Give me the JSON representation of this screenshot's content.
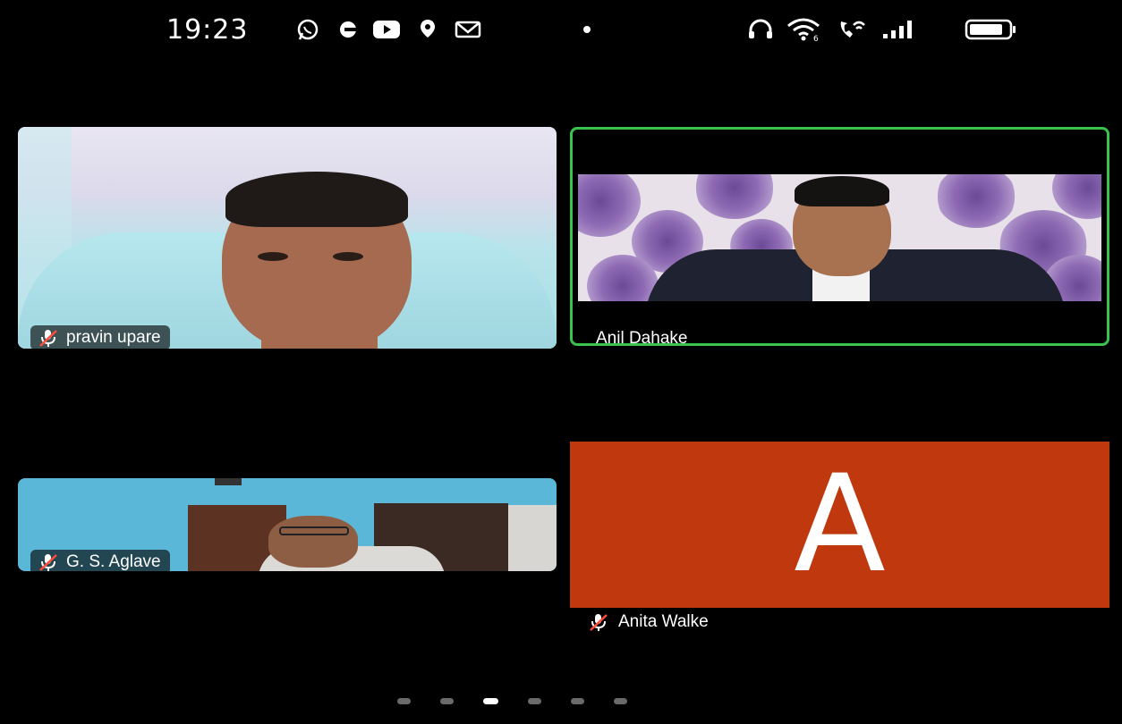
{
  "status_bar": {
    "time": "19:23",
    "left_icons": [
      "whatsapp-icon",
      "pill-icon",
      "youtube-icon",
      "location-icon",
      "gmail-icon",
      "dot-icon"
    ],
    "right_icons": [
      "headphones-icon",
      "wifi-icon",
      "wifi-calling-icon",
      "signal-icon",
      "battery-icon"
    ]
  },
  "participants": [
    {
      "name": "pravin upare",
      "muted": true,
      "video": true,
      "speaking": false
    },
    {
      "name": "Anil Dahake",
      "muted": false,
      "video": true,
      "speaking": true
    },
    {
      "name": "G. S. Aglave",
      "muted": true,
      "video": true,
      "speaking": false
    },
    {
      "name": "Anita Walke",
      "muted": true,
      "video": false,
      "speaking": false,
      "avatar_letter": "A",
      "avatar_color": "#c0390e"
    }
  ],
  "colors": {
    "active_speaker_border": "#3ac24f",
    "background": "#000000"
  },
  "pager": {
    "pages": 6,
    "current": 3
  }
}
